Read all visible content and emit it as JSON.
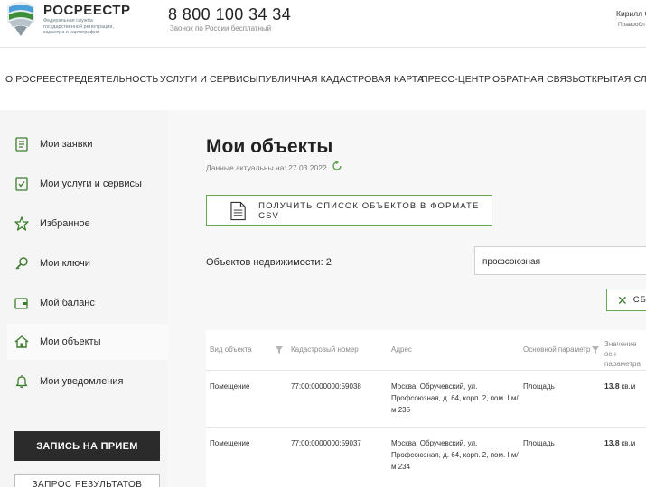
{
  "header": {
    "logo_title": "РОСРЕЕСТР",
    "logo_subtitle": "Федеральная служба государственной регистрации, кадастра и картографии",
    "phone": "8 800 100 34 34",
    "phone_note": "Звонок по России бесплатный",
    "user_name": "Кирилл С",
    "user_role": "Правообл"
  },
  "nav": {
    "items": [
      "О РОСРЕЕСТРЕ",
      "ДЕЯТЕЛЬНОСТЬ",
      "УСЛУГИ И СЕРВИСЫ",
      "ПУБЛИЧНАЯ КАДАСТРОВАЯ КАРТА",
      "ПРЕСС-ЦЕНТР",
      "ОБРАТНАЯ СВЯЗЬ",
      "ОТКРЫТАЯ СЛУ"
    ]
  },
  "sidebar": {
    "items": [
      {
        "label": "Мои заявки",
        "icon": "document-list-icon"
      },
      {
        "label": "Мои услуги и сервисы",
        "icon": "checklist-icon"
      },
      {
        "label": "Избранное",
        "icon": "star-icon"
      },
      {
        "label": "Мои ключи",
        "icon": "key-icon"
      },
      {
        "label": "Мой баланс",
        "icon": "wallet-icon"
      },
      {
        "label": "Мои объекты",
        "icon": "house-icon"
      },
      {
        "label": "Мои уведомления",
        "icon": "bell-icon"
      }
    ],
    "active_index": 5,
    "appointment_button": "ЗАПИСЬ НА ПРИЕМ",
    "results_button": "ЗАПРОС РЕЗУЛЬТАТОВ"
  },
  "main": {
    "title": "Мои объекты",
    "data_date": "Данные актуальны на: 27.03.2022",
    "csv_button": "ПОЛУЧИТЬ СПИСОК ОБЪЕКТОВ В ФОРМАТЕ CSV",
    "count_label": "Объектов недвижимости: 2",
    "search_value": "профсоюзная",
    "reset_button": "СБ"
  },
  "table": {
    "columns": [
      "Вид объекта",
      "Кадастровый номер",
      "Адрес",
      "Основной параметр",
      "Значение осн параметра"
    ],
    "rows": [
      {
        "type": "Помещение",
        "cadastral": "77:00:0000000:59038",
        "address": "Москва, Обручевский, ул. Профсоюзная, д. 64, корп. 2, пом. I м/м 235",
        "param": "Площадь",
        "value": "13.8",
        "unit": "кв.м"
      },
      {
        "type": "Помещение",
        "cadastral": "77:00:0000000:59037",
        "address": "Москва, Обручевский, ул. Профсоюзная, д. 64, корп. 2, пом. I м/м 234",
        "param": "Площадь",
        "value": "13.8",
        "unit": "кв.м"
      }
    ]
  },
  "colors": {
    "accent_green": "#6aa84f",
    "dark_button": "#2b2b2b",
    "sidebar_bg": "#f5f5f5"
  }
}
